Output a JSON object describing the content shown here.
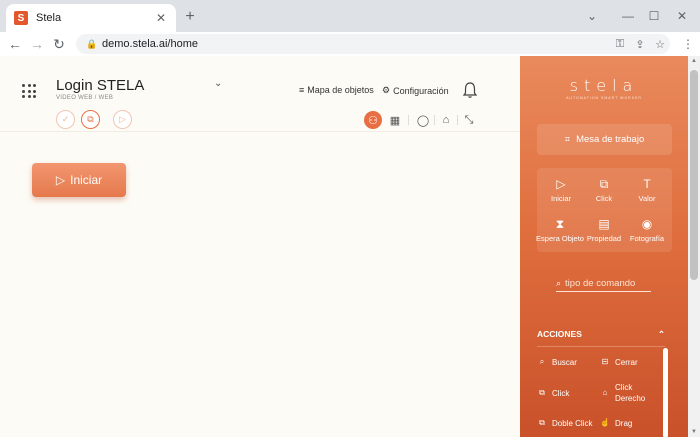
{
  "browser": {
    "tab_title": "Stela",
    "favicon_letter": "S",
    "url": "demo.stela.ai/home",
    "new_tab": "+",
    "close": "✕"
  },
  "header": {
    "title": "Login STELA",
    "subtitle": "VIDEO WEB / WEB",
    "mapa": "Mapa de objetos",
    "config": "Configuración"
  },
  "main": {
    "iniciar": "Iniciar"
  },
  "panel": {
    "logo": "stela",
    "logo_tagline": "AUTOMATION SMART WORKER",
    "mesa": "Mesa de trabajo",
    "commands": [
      {
        "label": "Iniciar",
        "icon": "play-icon"
      },
      {
        "label": "Click",
        "icon": "click-icon"
      },
      {
        "label": "Valor",
        "icon": "text-icon"
      },
      {
        "label": "Espera Objeto",
        "icon": "wait-object-icon"
      },
      {
        "label": "Propiedad",
        "icon": "property-icon"
      },
      {
        "label": "Fotografía",
        "icon": "camera-icon"
      }
    ],
    "search_placeholder": "tipo de comando",
    "acciones": "ACCIONES",
    "actions": [
      {
        "label": "Buscar",
        "icon": "search-icon"
      },
      {
        "label": "Cerrar",
        "icon": "close-window-icon"
      },
      {
        "label": "Click",
        "icon": "click-icon"
      },
      {
        "label": "Click Derecho",
        "icon": "mouse-icon"
      },
      {
        "label": "Doble Click",
        "icon": "double-click-icon"
      },
      {
        "label": "Drag",
        "icon": "drag-icon"
      }
    ]
  },
  "colors": {
    "accent": "#e86f44",
    "panel_top": "#e98a5d",
    "panel_bottom": "#c9512a"
  }
}
